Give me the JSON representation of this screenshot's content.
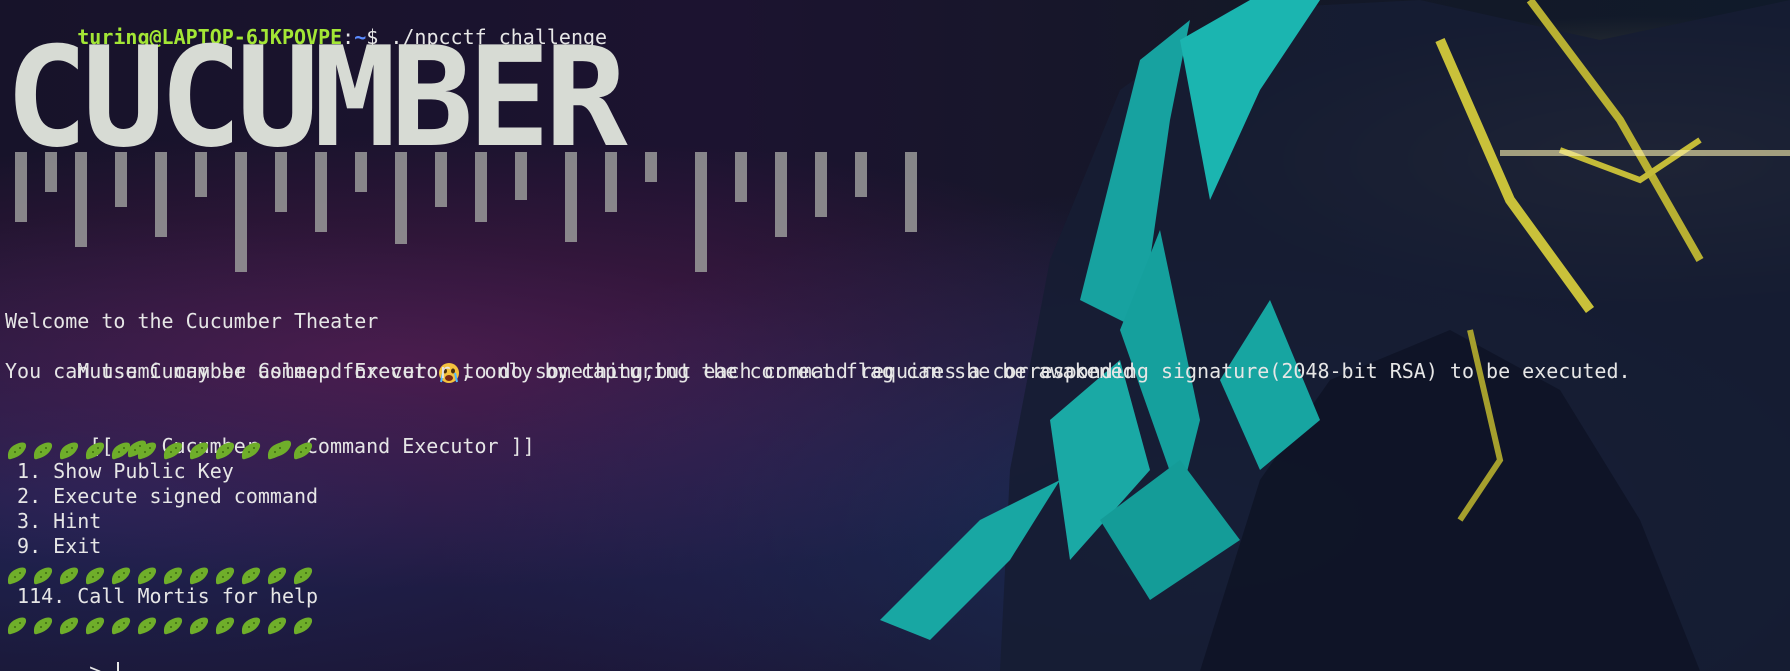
{
  "prompt": {
    "user_host": "turing@LAPTOP-6JKPOVPE",
    "separator": ":",
    "path": "~",
    "symbol": "$",
    "command": " ./npcctf_challenge"
  },
  "banner": {
    "art_text": "CUCUMBER"
  },
  "intro": {
    "line1": "Welcome to the Cucumber Theater",
    "line2_prefix": "Mutsumi may be asleep forever ",
    "line2_suffix": ", only by capturing the correct flag can she be awakened",
    "line3": "You can use Cucumber Command Executor to do something,but each command requires a corresponding signature(2048-bit RSA) to be executed."
  },
  "menu": {
    "title_open": " [[ ",
    "title_word": " Cucumber ",
    "title_word2": " Command Executor ]]",
    "items": [
      " 1. Show Public Key",
      " 2. Execute signed command",
      " 3. Hint",
      " 9. Exit"
    ],
    "extra": " 114. Call Mortis for help",
    "input_prompt": " > "
  },
  "icons": {
    "pickle": "pickle-icon",
    "crying_face": "crying-face-icon"
  },
  "colors": {
    "user_host": "#a3e635",
    "path": "#5b8cff",
    "text": "#e6e6e6",
    "pickle": "#6fae2a"
  }
}
